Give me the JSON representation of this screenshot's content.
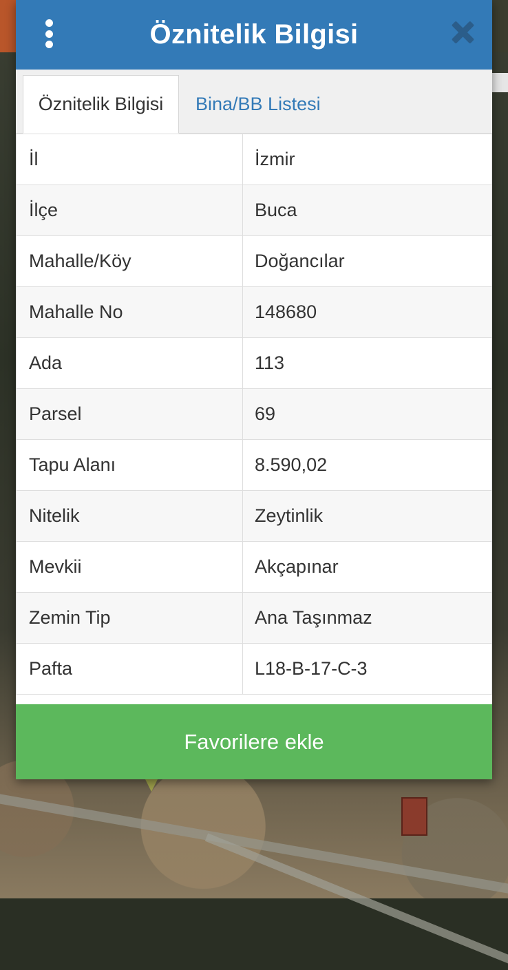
{
  "dialog": {
    "title": "Öznitelik Bilgisi",
    "menu_icon": "kebab-menu-icon",
    "close_icon": "close-icon"
  },
  "tabs": [
    {
      "label": "Öznitelik Bilgisi",
      "active": true
    },
    {
      "label": "Bina/BB Listesi",
      "active": false
    }
  ],
  "attributes": [
    {
      "key": "İl",
      "value": "İzmir"
    },
    {
      "key": "İlçe",
      "value": "Buca"
    },
    {
      "key": "Mahalle/Köy",
      "value": "Doğancılar"
    },
    {
      "key": "Mahalle No",
      "value": "148680"
    },
    {
      "key": "Ada",
      "value": "113"
    },
    {
      "key": "Parsel",
      "value": "69"
    },
    {
      "key": "Tapu Alanı",
      "value": "8.590,02"
    },
    {
      "key": "Nitelik",
      "value": "Zeytinlik"
    },
    {
      "key": "Mevkii",
      "value": "Akçapınar"
    },
    {
      "key": "Zemin Tip",
      "value": "Ana Taşınmaz"
    },
    {
      "key": "Pafta",
      "value": "L18-B-17-C-3"
    }
  ],
  "actions": {
    "favorite_label": "Favorilere ekle"
  },
  "colors": {
    "header": "#337ab7",
    "link": "#337ab7",
    "button": "#5cb85c",
    "close": "#2b5d8a"
  }
}
